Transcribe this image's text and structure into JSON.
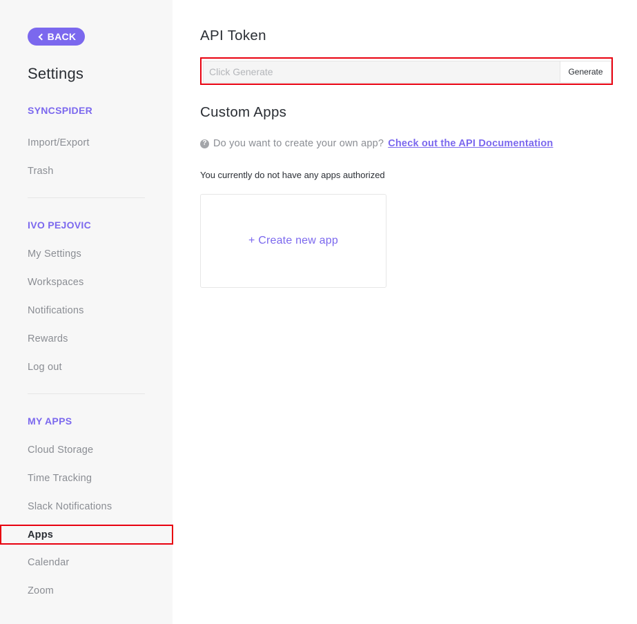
{
  "sidebar": {
    "back_label": "BACK",
    "title": "Settings",
    "sections": [
      {
        "heading": "SYNCSPIDER",
        "items": [
          "Import/Export",
          "Trash"
        ]
      },
      {
        "heading": "IVO PEJOVIC",
        "items": [
          "My Settings",
          "Workspaces",
          "Notifications",
          "Rewards",
          "Log out"
        ]
      },
      {
        "heading": "MY APPS",
        "items": [
          "Cloud Storage",
          "Time Tracking",
          "Slack Notifications",
          "Apps",
          "Calendar",
          "Zoom"
        ]
      }
    ],
    "active_item": "Apps"
  },
  "api_token": {
    "heading": "API Token",
    "placeholder": "Click Generate",
    "value": "",
    "generate_label": "Generate"
  },
  "custom_apps": {
    "heading": "Custom Apps",
    "help_text": "Do you want to create your own app?",
    "doc_link": "Check out the API Documentation",
    "status": "You currently do not have any apps authorized",
    "create_label": "+ Create new app"
  },
  "colors": {
    "accent": "#7b68ee",
    "highlight": "#e8000f",
    "sidebar_bg": "#f7f7f7"
  }
}
